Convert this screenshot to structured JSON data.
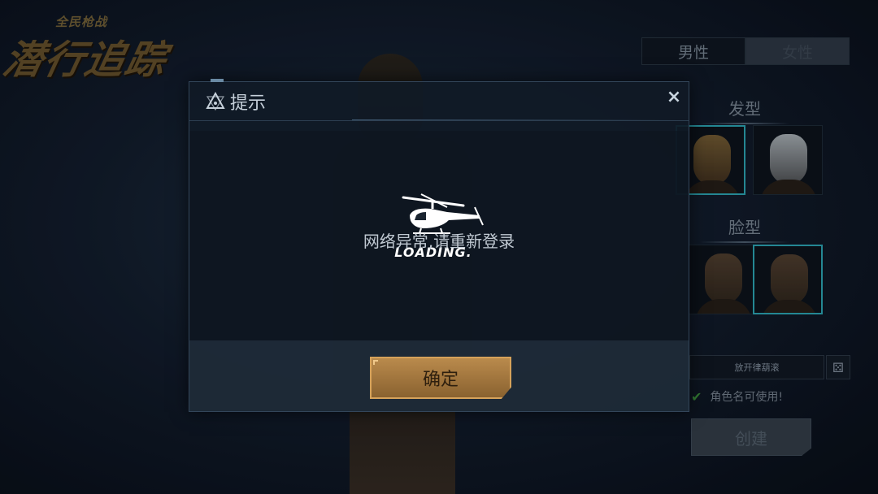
{
  "background": {
    "logo": {
      "subtitle": "全民枪战",
      "title": "潜行追踪"
    },
    "gender_tabs": [
      {
        "label": "男性"
      },
      {
        "label": "女性"
      }
    ],
    "hairstyle_title": "发型",
    "face_title": "脸型",
    "name_field_value": "放开律葫滚",
    "name_status": "角色名可使用!",
    "create_label": "创建"
  },
  "dialog": {
    "title": "提示",
    "close_icon": "×",
    "message": "网络异常,请重新登录",
    "loading_text": "LOADING.",
    "confirm_label": "确定"
  }
}
